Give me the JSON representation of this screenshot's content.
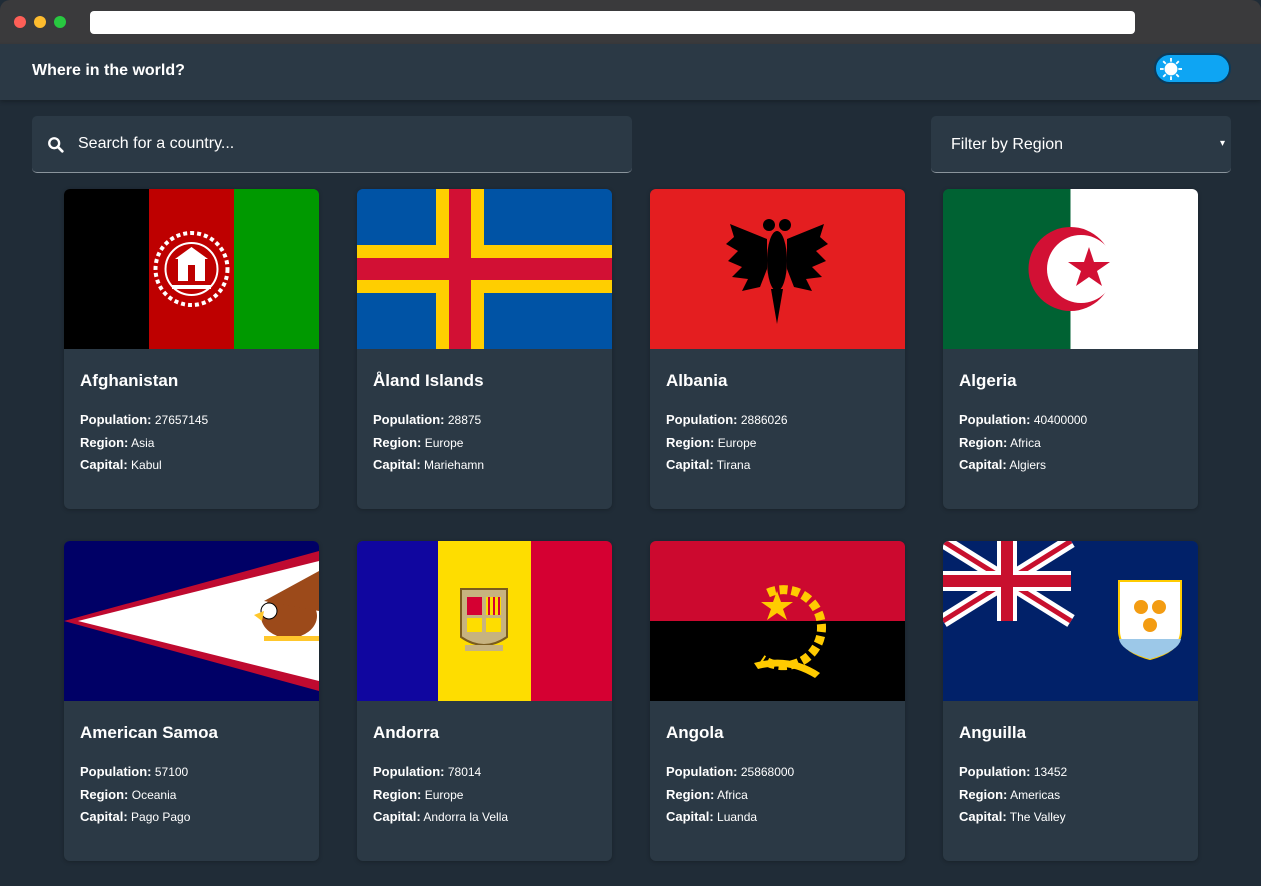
{
  "header": {
    "title": "Where in the world?"
  },
  "search": {
    "placeholder": "Search for a country..."
  },
  "filter": {
    "label": "Filter by Region",
    "caret": "▾"
  },
  "labels": {
    "population": "Population:",
    "region": "Region:",
    "capital": "Capital:"
  },
  "countries": [
    {
      "name": "Afghanistan",
      "population": "27657145",
      "region": "Asia",
      "capital": "Kabul",
      "flag": "afghanistan-flag"
    },
    {
      "name": "Åland Islands",
      "population": "28875",
      "region": "Europe",
      "capital": "Mariehamn",
      "flag": "aland-flag"
    },
    {
      "name": "Albania",
      "population": "2886026",
      "region": "Europe",
      "capital": "Tirana",
      "flag": "albania-flag"
    },
    {
      "name": "Algeria",
      "population": "40400000",
      "region": "Africa",
      "capital": "Algiers",
      "flag": "algeria-flag"
    },
    {
      "name": "American Samoa",
      "population": "57100",
      "region": "Oceania",
      "capital": "Pago Pago",
      "flag": "american-samoa-flag"
    },
    {
      "name": "Andorra",
      "population": "78014",
      "region": "Europe",
      "capital": "Andorra la Vella",
      "flag": "andorra-flag"
    },
    {
      "name": "Angola",
      "population": "25868000",
      "region": "Africa",
      "capital": "Luanda",
      "flag": "angola-flag"
    },
    {
      "name": "Anguilla",
      "population": "13452",
      "region": "Americas",
      "capital": "The Valley",
      "flag": "anguilla-flag"
    }
  ],
  "colors": {
    "background": "#202c37",
    "surface": "#2b3945",
    "toggle": "#0ea5f3"
  }
}
